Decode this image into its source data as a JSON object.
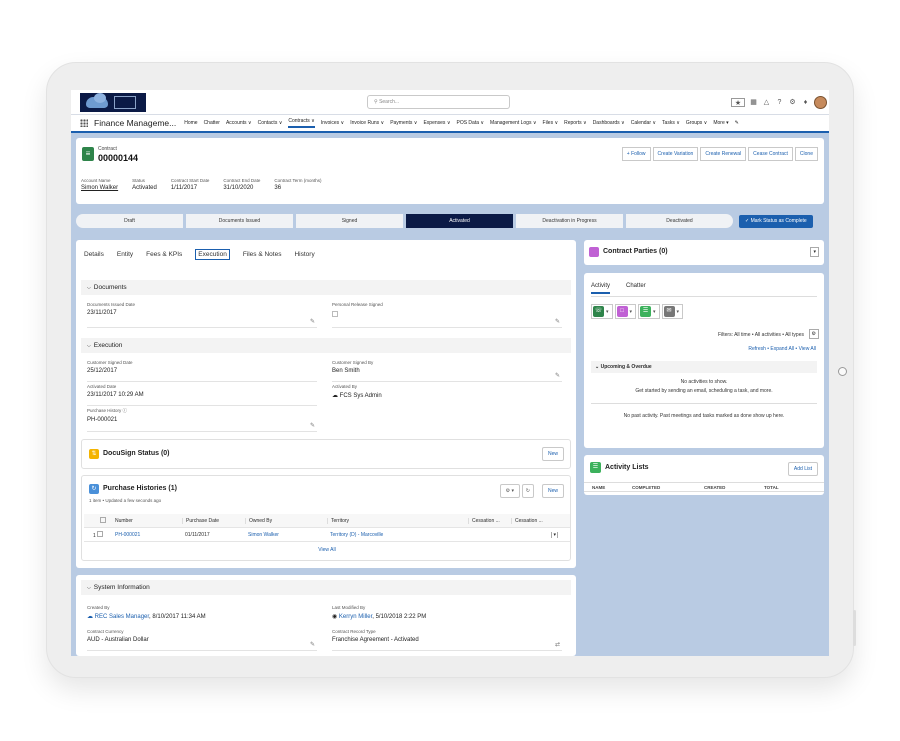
{
  "global": {
    "search_placeholder": "Search..."
  },
  "nav": {
    "app_name": "Finance Manageme...",
    "items": [
      "Home",
      "Chatter",
      "Accounts ∨",
      "Contacts ∨",
      "Contracts ∨",
      "Invoices ∨",
      "Invoice Runs ∨",
      "Payments ∨",
      "Expenses ∨",
      "POS Data ∨",
      "Management Logs ∨",
      "Files ∨",
      "Reports ∨",
      "Dashboards ∨",
      "Calendar ∨",
      "Tasks ∨",
      "Groups ∨",
      "More ▾"
    ]
  },
  "record": {
    "type": "Contract",
    "number": "00000144",
    "buttons": [
      "+ Follow",
      "Create Variation",
      "Create Renewal",
      "Cease Contract",
      "Clone"
    ],
    "fields": [
      {
        "label": "Account Name",
        "value": "Simon Walker"
      },
      {
        "label": "Status",
        "value": "Activated"
      },
      {
        "label": "Contract Start Date",
        "value": "1/11/2017"
      },
      {
        "label": "Contract End Date",
        "value": "31/10/2020"
      },
      {
        "label": "Contract Term (months)",
        "value": "36"
      }
    ]
  },
  "path": {
    "steps": [
      "Draft",
      "Documents Issued",
      "Signed",
      "Activated",
      "Deactivation in Progress",
      "Deactivated"
    ],
    "current": "Activated",
    "mark_button": "✓ Mark Status as Complete"
  },
  "tabs": [
    "Details",
    "Entity",
    "Fees & KPIs",
    "Execution",
    "Files & Notes",
    "History"
  ],
  "active_tab": "Execution",
  "documents": {
    "title": "Documents",
    "issued_date_label": "Documents Issued Date",
    "issued_date": "23/11/2017",
    "release_label": "Personal Release Signed"
  },
  "execution": {
    "title": "Execution",
    "customer_signed_date_label": "Customer Signed Date",
    "customer_signed_date": "25/12/2017",
    "customer_signed_by_label": "Customer Signed By",
    "customer_signed_by": "Ben Smith",
    "activated_date_label": "Activated Date",
    "activated_date": "23/11/2017 10:29 AM",
    "activated_by_label": "Activated By",
    "activated_by": "FCS Sys Admin",
    "purchase_history_label": "Purchase History",
    "purchase_history": "PH-000021"
  },
  "docusign": {
    "title": "DocuSign Status (0)",
    "button": "New"
  },
  "purchase": {
    "title": "Purchase Histories (1)",
    "subtitle": "1 item • Updated a few seconds ago",
    "button": "New",
    "columns": [
      "Number",
      "Purchase Date",
      "Owned By",
      "Territory",
      "Cessation ...",
      "Cessation ..."
    ],
    "rows": [
      {
        "idx": "1",
        "number": "PH-000021",
        "date": "01/11/2017",
        "owner": "Simon Walker",
        "territory": "Territory (D) - Marcoville"
      }
    ],
    "view_all": "View All"
  },
  "system": {
    "title": "System Information",
    "created_by_label": "Created By",
    "created_by": "REC Sales Manager",
    "created_date": ", 8/10/2017 11:34 AM",
    "modified_by_label": "Last Modified By",
    "modified_by": "Kerryn Miller",
    "modified_date": ", 5/10/2018 2:22 PM",
    "currency_label": "Contract Currency",
    "currency": "AUD - Australian Dollar",
    "record_type_label": "Contract Record Type",
    "record_type": "Franchise Agreement - Activated"
  },
  "parties": {
    "title": "Contract Parties (0)"
  },
  "activity": {
    "tabs": [
      "Activity",
      "Chatter"
    ],
    "filters": "Filters: All time • All activities • All types",
    "links": "Refresh • Expand All • View All",
    "upcoming": "Upcoming & Overdue",
    "no_activities": "No activities to show.",
    "get_started": "Get started by sending an email, scheduling a task, and more.",
    "no_past": "No past activity. Past meetings and tasks marked as done show up here."
  },
  "activity_lists": {
    "title": "Activity Lists",
    "button": "Add List",
    "columns": [
      "NAME",
      "COMPLETED",
      "CREATED",
      "TOTAL"
    ]
  },
  "colors": {
    "brand": "#1b5fae",
    "path_current": "#0b1a46",
    "contract_icon": "#2e844a"
  }
}
